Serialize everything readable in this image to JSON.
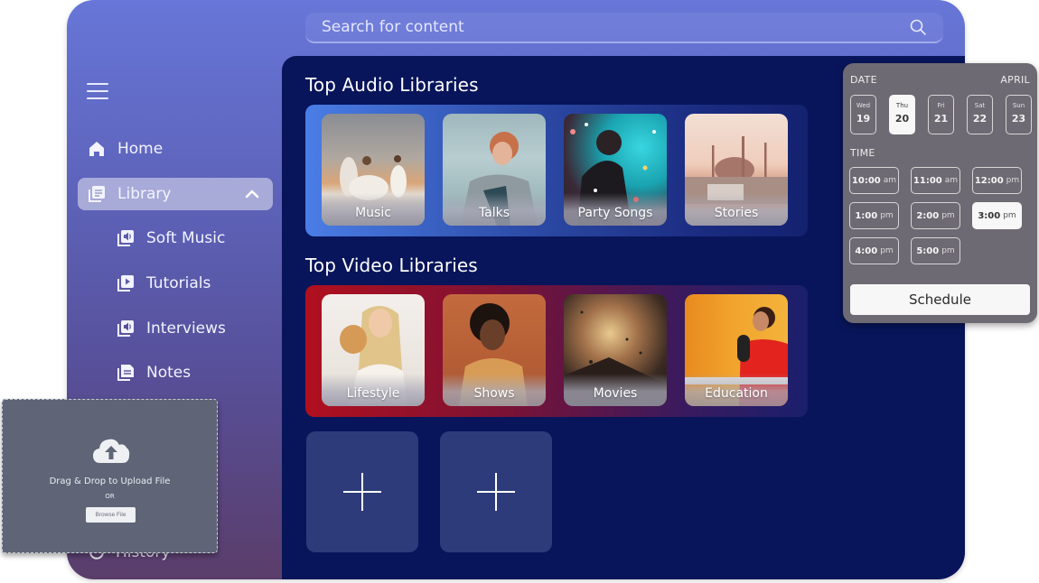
{
  "search": {
    "placeholder": "Search for content"
  },
  "sidebar": {
    "items": [
      {
        "label": "Home",
        "icon": "home-icon"
      },
      {
        "label": "Library",
        "icon": "library-icon",
        "expanded": true,
        "active": true
      },
      {
        "label": "Soft Music",
        "icon": "audio-library-icon"
      },
      {
        "label": "Tutorials",
        "icon": "video-library-icon"
      },
      {
        "label": "Interviews",
        "icon": "audio-library-icon"
      },
      {
        "label": "Notes",
        "icon": "notes-icon"
      },
      {
        "label": "History",
        "icon": "history-icon"
      }
    ]
  },
  "main": {
    "audio": {
      "title": "Top Audio Libraries",
      "tiles": [
        {
          "label": "Music"
        },
        {
          "label": "Talks"
        },
        {
          "label": "Party Songs"
        },
        {
          "label": "Stories"
        }
      ]
    },
    "video": {
      "title": "Top Video Libraries",
      "tiles": [
        {
          "label": "Lifestyle"
        },
        {
          "label": "Shows"
        },
        {
          "label": "Movies"
        },
        {
          "label": "Education"
        }
      ]
    },
    "add_tiles": [
      {
        "icon": "plus-icon"
      },
      {
        "icon": "plus-icon"
      }
    ]
  },
  "scheduler": {
    "date_label": "DATE",
    "month": "APRIL",
    "days": [
      {
        "name": "Wed",
        "date": "19"
      },
      {
        "name": "Thu",
        "date": "20",
        "selected": true
      },
      {
        "name": "Fri",
        "date": "21"
      },
      {
        "name": "Sat",
        "date": "22"
      },
      {
        "name": "Sun",
        "date": "23"
      }
    ],
    "time_label": "TIME",
    "slots": [
      {
        "time": "10:00",
        "period": "am"
      },
      {
        "time": "11:00",
        "period": "am"
      },
      {
        "time": "12:00",
        "period": "pm"
      },
      {
        "time": "1:00",
        "period": "pm"
      },
      {
        "time": "2:00",
        "period": "pm"
      },
      {
        "time": "3:00",
        "period": "pm",
        "selected": true
      },
      {
        "time": "4:00",
        "period": "pm"
      },
      {
        "time": "5:00",
        "period": "pm"
      }
    ],
    "button": "Schedule"
  },
  "upload": {
    "title": "Drag & Drop to Upload File",
    "or": "OR",
    "button": "Browse File"
  }
}
